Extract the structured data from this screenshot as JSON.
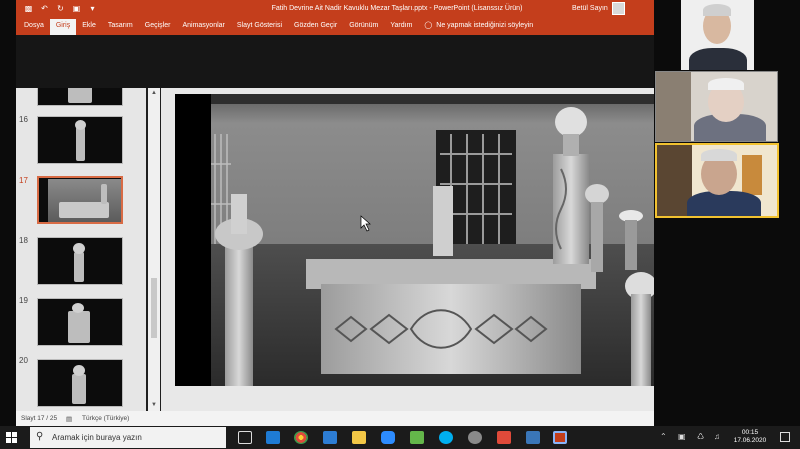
{
  "window": {
    "title": "Fatih Devrine Ait Nadir Kavuklu Mezar Taşları.pptx - PowerPoint (Lisanssız Ürün)",
    "user_name": "Betül Sayın",
    "accent": "#c43e1c"
  },
  "ribbon": {
    "tabs": [
      {
        "label": "Dosya"
      },
      {
        "label": "Giriş"
      },
      {
        "label": "Ekle"
      },
      {
        "label": "Tasarım"
      },
      {
        "label": "Geçişler"
      },
      {
        "label": "Animasyonlar"
      },
      {
        "label": "Slayt Gösterisi"
      },
      {
        "label": "Gözden Geçir"
      },
      {
        "label": "Görünüm"
      },
      {
        "label": "Yardım"
      }
    ],
    "tell_me": "Ne yapmak istediğinizi söyleyin"
  },
  "thumbnails": [
    {
      "number": "16"
    },
    {
      "number": "17"
    },
    {
      "number": "18"
    },
    {
      "number": "19"
    },
    {
      "number": "20"
    }
  ],
  "statusbar": {
    "slide_counter": "Slayt 17 / 25",
    "language": "Türkçe (Türkiye)"
  },
  "taskbar": {
    "search_placeholder": "Aramak için buraya yazın",
    "time": "00:15",
    "date": "17.06.2020"
  },
  "icons": {
    "save": "save-icon",
    "undo": "undo-icon",
    "redo": "redo-icon",
    "lightbulb": "lightbulb-icon"
  }
}
